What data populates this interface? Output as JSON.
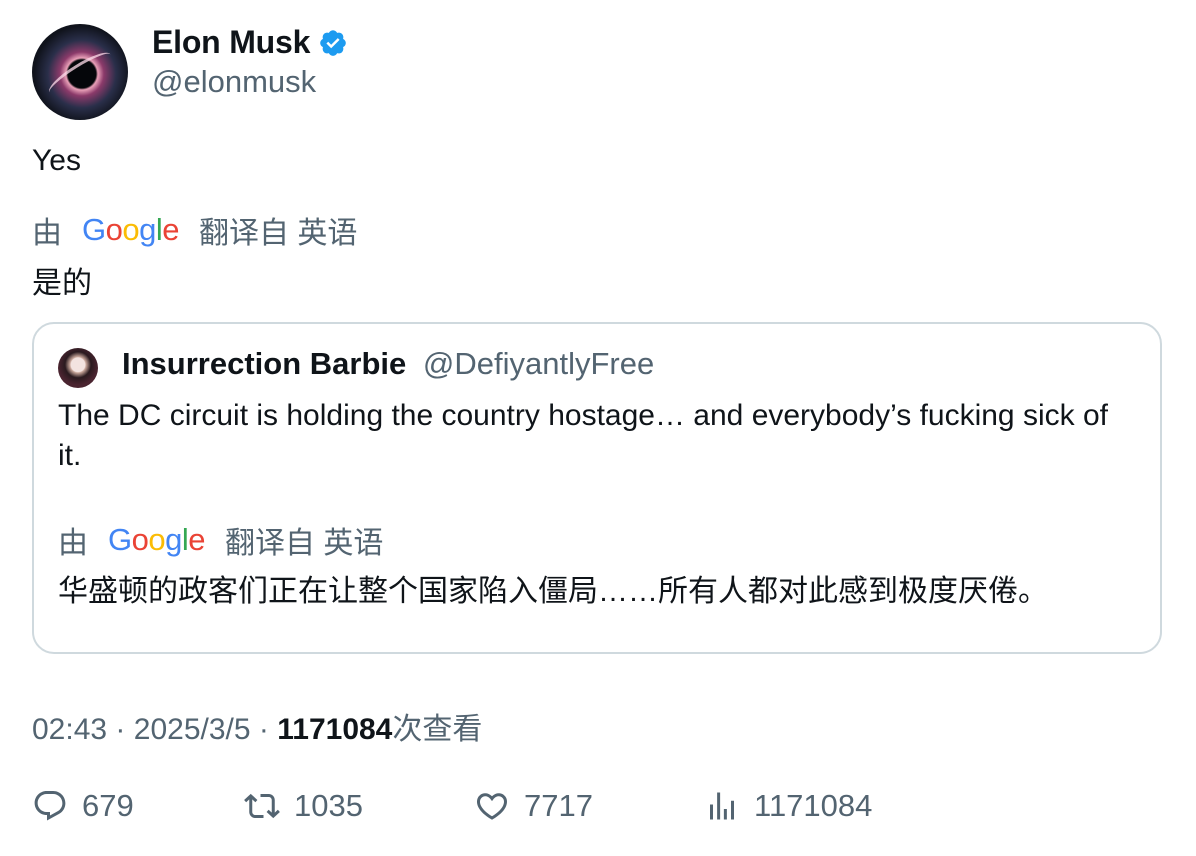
{
  "author": {
    "name": "Elon Musk",
    "handle": "@elonmusk",
    "verified": true,
    "verified_color": "#1d9bf0"
  },
  "tweet": {
    "text": "Yes",
    "translation": {
      "prefix": "由",
      "provider": "Google",
      "suffix": "翻译自 英语",
      "text": "是的"
    }
  },
  "quote": {
    "name": "Insurrection Barbie",
    "handle": "@DefiyantlyFree",
    "text": "The DC circuit is holding the country hostage… and everybody’s fucking sick of it.",
    "translation": {
      "prefix": "由",
      "provider": "Google",
      "suffix": "翻译自 英语",
      "text": "华盛顿的政客们正在让整个国家陷入僵局……所有人都对此感到极度厌倦。"
    }
  },
  "meta": {
    "time": "02:43",
    "separator": "·",
    "date": "2025/3/5",
    "views_count": "1171084",
    "views_label": "次查看"
  },
  "actions": {
    "replies": "679",
    "retweets": "1035",
    "likes": "7717",
    "views": "1171084"
  },
  "icons": [
    "verified-badge-icon",
    "reply-icon",
    "retweet-icon",
    "like-icon",
    "views-icon"
  ]
}
